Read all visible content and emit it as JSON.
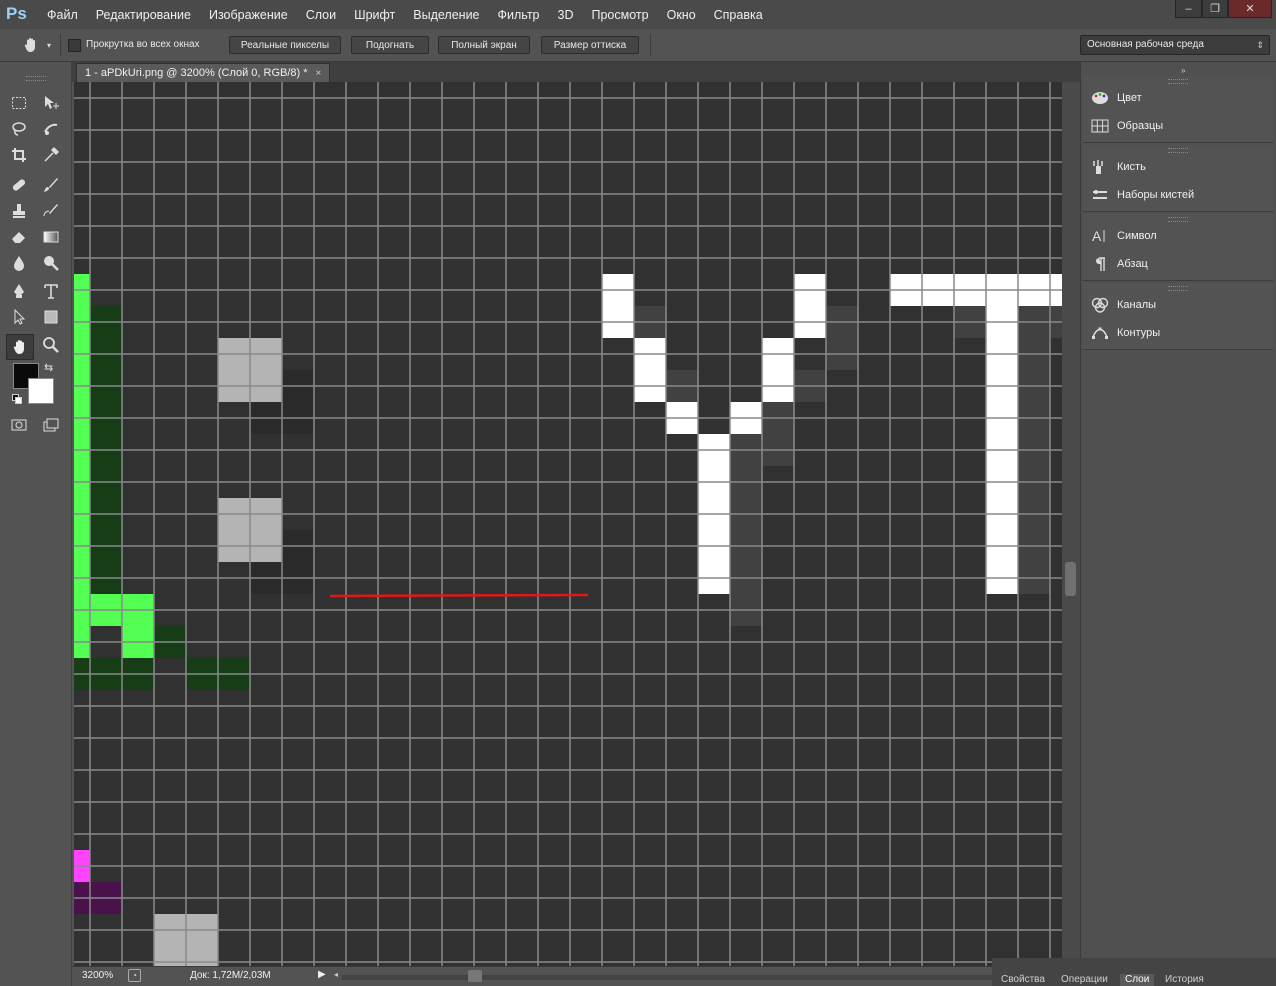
{
  "app": {
    "logo": "Ps"
  },
  "menu": [
    "Файл",
    "Редактирование",
    "Изображение",
    "Слои",
    "Шрифт",
    "Выделение",
    "Фильтр",
    "3D",
    "Просмотр",
    "Окно",
    "Справка"
  ],
  "window_controls": {
    "minimize": "–",
    "restore": "❐",
    "close": "✕"
  },
  "options": {
    "scroll_all_label": "Прокрутка во всех окнах",
    "actual_pixels": "Реальные пикселы",
    "fit": "Подогнать",
    "full_screen": "Полный экран",
    "print_size": "Размер оттиска",
    "workspace": "Основная рабочая среда"
  },
  "document": {
    "tab_title": "1 - aPDkUri.png @ 3200% (Слой 0, RGB/8) *",
    "close": "×"
  },
  "status": {
    "zoom": "3200%",
    "doc": "Док: 1,72M/2,03M"
  },
  "panels": {
    "group1": [
      "Цвет",
      "Образцы"
    ],
    "group2": [
      "Кисть",
      "Наборы кистей"
    ],
    "group3": [
      "Символ",
      "Абзац"
    ],
    "group4": [
      "Каналы",
      "Контуры"
    ]
  },
  "bottom_tabs": [
    "Свойства",
    "Операции",
    "Слои",
    "История"
  ],
  "colors": {
    "foreground": "#0a0a0a",
    "background": "#ffffff",
    "canvas_bg": "#313131",
    "grid": "#8a8a8a",
    "green_bright": "#54ff54",
    "green_dark": "#163d16",
    "magenta_bright": "#ff44ff",
    "magenta_dark": "#4a124a",
    "white": "#ffffff",
    "light_gray": "#b4b4b4",
    "mid_gray": "#414141",
    "dark_gray": "#2a2a2a",
    "red_line": "#e01818"
  }
}
